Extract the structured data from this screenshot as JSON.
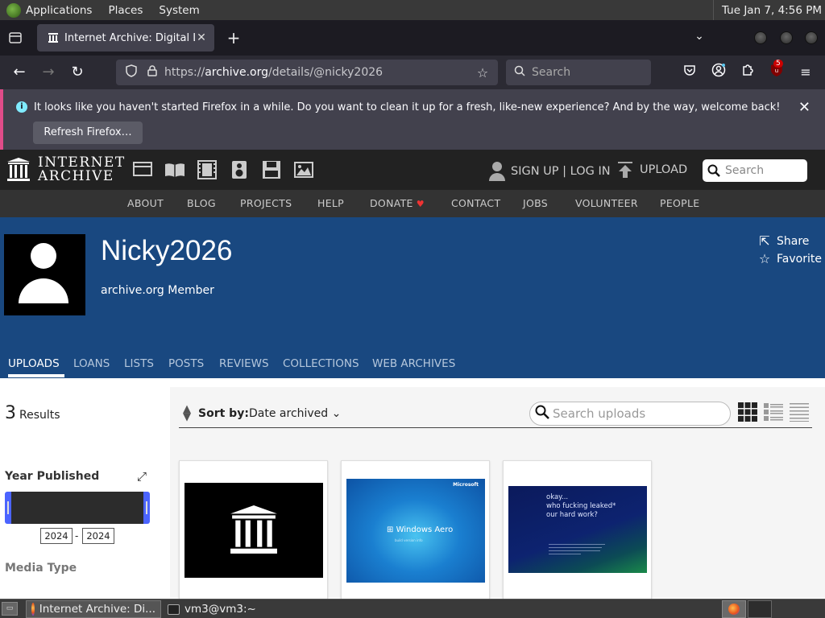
{
  "system_panel": {
    "menus": [
      "Applications",
      "Places",
      "System"
    ],
    "clock": "Tue Jan  7,  4:56 PM"
  },
  "browser": {
    "tab_title": "Internet Archive: Digital Libr",
    "url_prefix": "https://",
    "url_domain": "archive.org",
    "url_path": "/details/@nicky2026",
    "search_placeholder": "Search",
    "extension_badge": "5"
  },
  "notification": {
    "message": "It looks like you haven't started Firefox in a while. Do you want to clean it up for a fresh, like-new experience? And by the way, welcome back!",
    "button": "Refresh Firefox…"
  },
  "ia_header": {
    "logo_line1": "INTERNET",
    "logo_line2": "ARCHIVE",
    "media_icons": [
      "web-icon",
      "texts-icon",
      "video-icon",
      "audio-icon",
      "software-icon",
      "images-icon"
    ],
    "signup": "SIGN UP | LOG IN",
    "upload": "UPLOAD",
    "search_placeholder": "Search"
  },
  "ia_menu": [
    "ABOUT",
    "BLOG",
    "PROJECTS",
    "HELP",
    "DONATE",
    "CONTACT",
    "JOBS",
    "VOLUNTEER",
    "PEOPLE"
  ],
  "profile": {
    "username": "Nicky2026",
    "role": "archive.org Member",
    "share": "Share",
    "favorite": "Favorite",
    "tabs": [
      "UPLOADS",
      "LOANS",
      "LISTS",
      "POSTS",
      "REVIEWS",
      "COLLECTIONS",
      "WEB ARCHIVES"
    ],
    "active_tab": "UPLOADS"
  },
  "results": {
    "count": "3",
    "label": "Results",
    "facet_title": "Year Published",
    "year_from": "2024",
    "year_to": "2024",
    "media_type": "Media Type"
  },
  "sort": {
    "label": "Sort by:",
    "value": "Date archived",
    "search_placeholder": "Search uploads"
  },
  "thumbnails": {
    "win_brand": "Microsoft",
    "win_title": "Windows Aero",
    "win_sub": "build version info",
    "leak_text": [
      "okay...",
      "who fucking leaked*",
      "our hard work?"
    ]
  },
  "taskbar": {
    "firefox_item": "Internet Archive: Di...",
    "terminal_item": "vm3@vm3:~"
  }
}
